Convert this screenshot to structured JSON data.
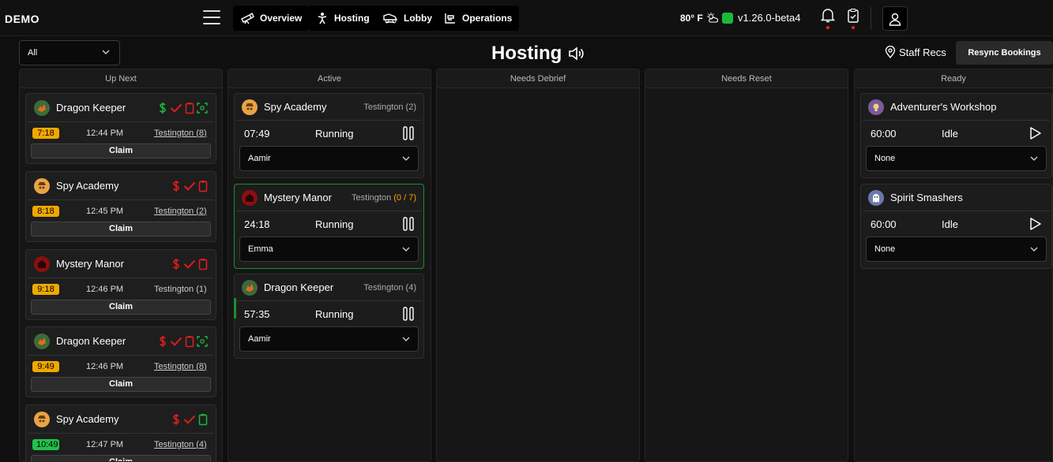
{
  "header": {
    "brand": "DEMO",
    "nav": [
      {
        "label": "Overview",
        "icon": "telescope-icon"
      },
      {
        "label": "Hosting",
        "icon": "host-icon"
      },
      {
        "label": "Lobby",
        "icon": "lobby-icon"
      },
      {
        "label": "Operations",
        "icon": "operations-icon"
      }
    ],
    "weather": "80° F",
    "version": "v1.26.0-beta4"
  },
  "toolbar": {
    "filter_value": "All",
    "page_title": "Hosting",
    "staff_recs": "Staff Recs",
    "resync": "Resync Bookings"
  },
  "columns": {
    "up_next": "Up Next",
    "active": "Active",
    "needs_debrief": "Needs Debrief",
    "needs_reset": "Needs Reset",
    "ready": "Ready"
  },
  "up_next": [
    {
      "name": "Dragon Keeper",
      "badge": "7:18",
      "time": "12:44 PM",
      "location": "Testington (8)",
      "claim": "Claim"
    },
    {
      "name": "Spy Academy",
      "badge": "8:18",
      "time": "12:45 PM",
      "location": "Testington (2)",
      "claim": "Claim"
    },
    {
      "name": "Mystery Manor",
      "badge": "9:18",
      "time": "12:46 PM",
      "location": "Testington (1)",
      "claim": "Claim"
    },
    {
      "name": "Dragon Keeper",
      "badge": "9:49",
      "time": "12:46 PM",
      "location": "Testington (8)",
      "claim": "Claim"
    },
    {
      "name": "Spy Academy",
      "badge": "10:49",
      "time": "12:47 PM",
      "location": "Testington (4)",
      "claim": "Claim"
    }
  ],
  "active": [
    {
      "name": "Spy Academy",
      "location": "Testington (2)",
      "clock": "07:49",
      "status": "Running",
      "host": "Aamir"
    },
    {
      "name": "Mystery Manor",
      "location": "Testington",
      "location_count": "(0 / 7)",
      "clock": "24:18",
      "status": "Running",
      "host": "Emma"
    },
    {
      "name": "Dragon Keeper",
      "location": "Testington (4)",
      "clock": "57:35",
      "status": "Running",
      "host": "Aamir"
    }
  ],
  "ready": [
    {
      "name": "Adventurer's Workshop",
      "clock": "60:00",
      "status": "Idle",
      "host": "None"
    },
    {
      "name": "Spirit Smashers",
      "clock": "60:00",
      "status": "Idle",
      "host": "None"
    }
  ],
  "colors": {
    "accent_green": "#1bb83a",
    "warning": "#f0a800",
    "danger": "#e01e1e"
  }
}
